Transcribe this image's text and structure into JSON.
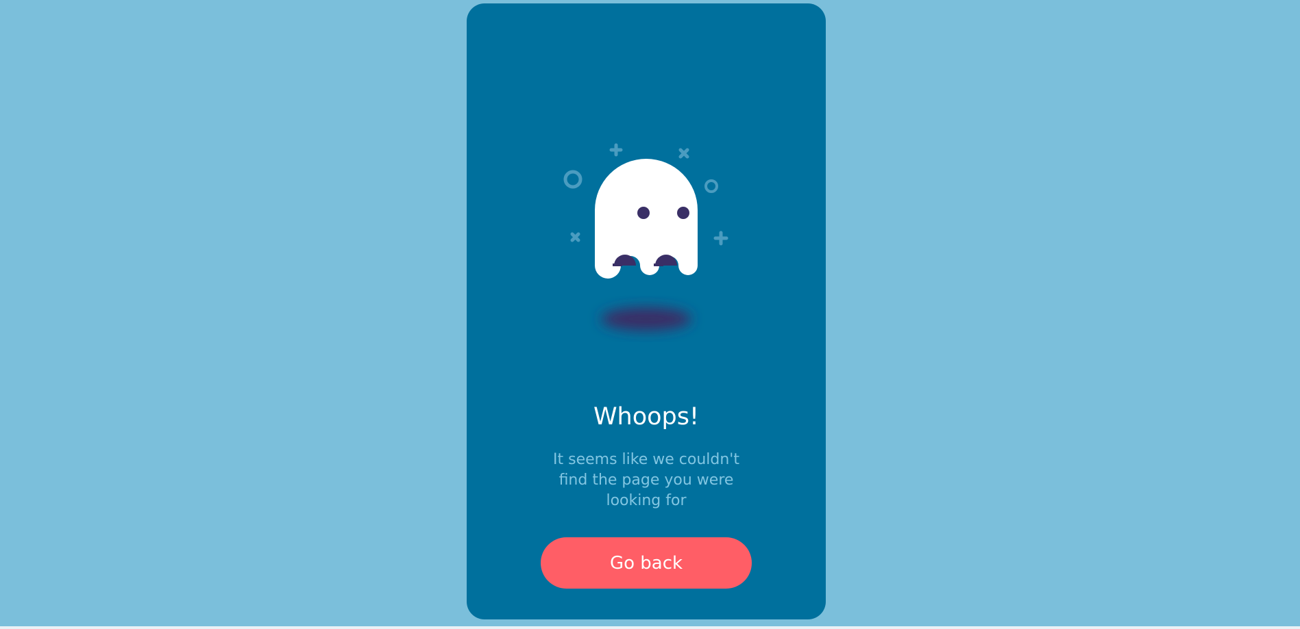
{
  "error_card": {
    "title": "Whoops!",
    "message": "It seems like we couldn't find the page you were looking for",
    "button_label": "Go back"
  },
  "illustration": {
    "icon": "ghost-icon",
    "decorations": [
      "plus-icon",
      "cross-icon",
      "ring-icon",
      "ring-icon",
      "cross-icon",
      "plus-icon"
    ]
  },
  "colors": {
    "page_background": "#7bbfdb",
    "card_background": "#00709d",
    "ghost": "#ffffff",
    "ghost_features": "#3a2f66",
    "decorations": "#4a9cc0",
    "button": "#ff5e66"
  }
}
